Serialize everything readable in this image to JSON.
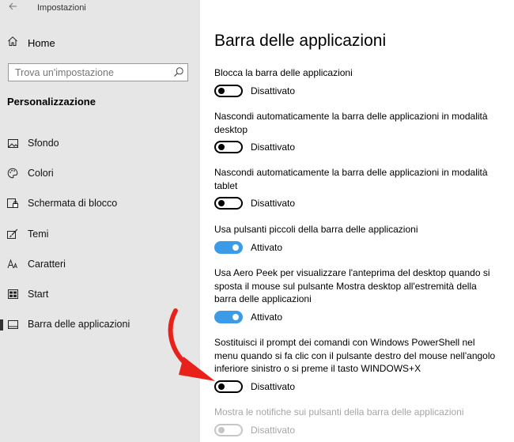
{
  "window": {
    "title": "Impostazioni"
  },
  "sidebar": {
    "home_label": "Home",
    "search": {
      "placeholder": "Trova un'impostazione",
      "value": ""
    },
    "section_heading": "Personalizzazione",
    "items": [
      {
        "label": "Sfondo",
        "icon": "picture-icon",
        "selected": false
      },
      {
        "label": "Colori",
        "icon": "palette-icon",
        "selected": false
      },
      {
        "label": "Schermata di blocco",
        "icon": "lock-screen-icon",
        "selected": false
      },
      {
        "label": "Temi",
        "icon": "brush-icon",
        "selected": false
      },
      {
        "label": "Caratteri",
        "icon": "font-icon",
        "selected": false
      },
      {
        "label": "Start",
        "icon": "start-menu-icon",
        "selected": false
      },
      {
        "label": "Barra delle applicazioni",
        "icon": "taskbar-icon",
        "selected": true
      }
    ]
  },
  "main": {
    "title": "Barra delle applicazioni",
    "settings": [
      {
        "desc": "Blocca la barra delle applicazioni",
        "state": "Disattivato",
        "on": false,
        "disabled": false
      },
      {
        "desc": "Nascondi automaticamente la barra delle applicazioni in modalità desktop",
        "state": "Disattivato",
        "on": false,
        "disabled": false
      },
      {
        "desc": "Nascondi automaticamente la barra delle applicazioni in modalità tablet",
        "state": "Disattivato",
        "on": false,
        "disabled": false
      },
      {
        "desc": "Usa pulsanti piccoli della barra delle applicazioni",
        "state": "Attivato",
        "on": true,
        "disabled": false
      },
      {
        "desc": "Usa Aero Peek per visualizzare l'anteprima del desktop quando si sposta il mouse sul pulsante Mostra desktop all'estremità della barra delle applicazioni",
        "state": "Attivato",
        "on": true,
        "disabled": false
      },
      {
        "desc": "Sostituisci il prompt dei comandi con Windows PowerShell nel menu quando si fa clic con il pulsante destro del mouse nell'angolo inferiore sinistro o si preme il tasto WINDOWS+X",
        "state": "Disattivato",
        "on": false,
        "disabled": false
      },
      {
        "desc": "Mostra le notifiche sui pulsanti della barra delle applicazioni",
        "state": "Disattivato",
        "on": false,
        "disabled": true
      }
    ]
  },
  "colors": {
    "accent": "#3b9be6",
    "annotation_arrow": "#e8221b",
    "sidebar_bg": "#e6e6e6"
  }
}
